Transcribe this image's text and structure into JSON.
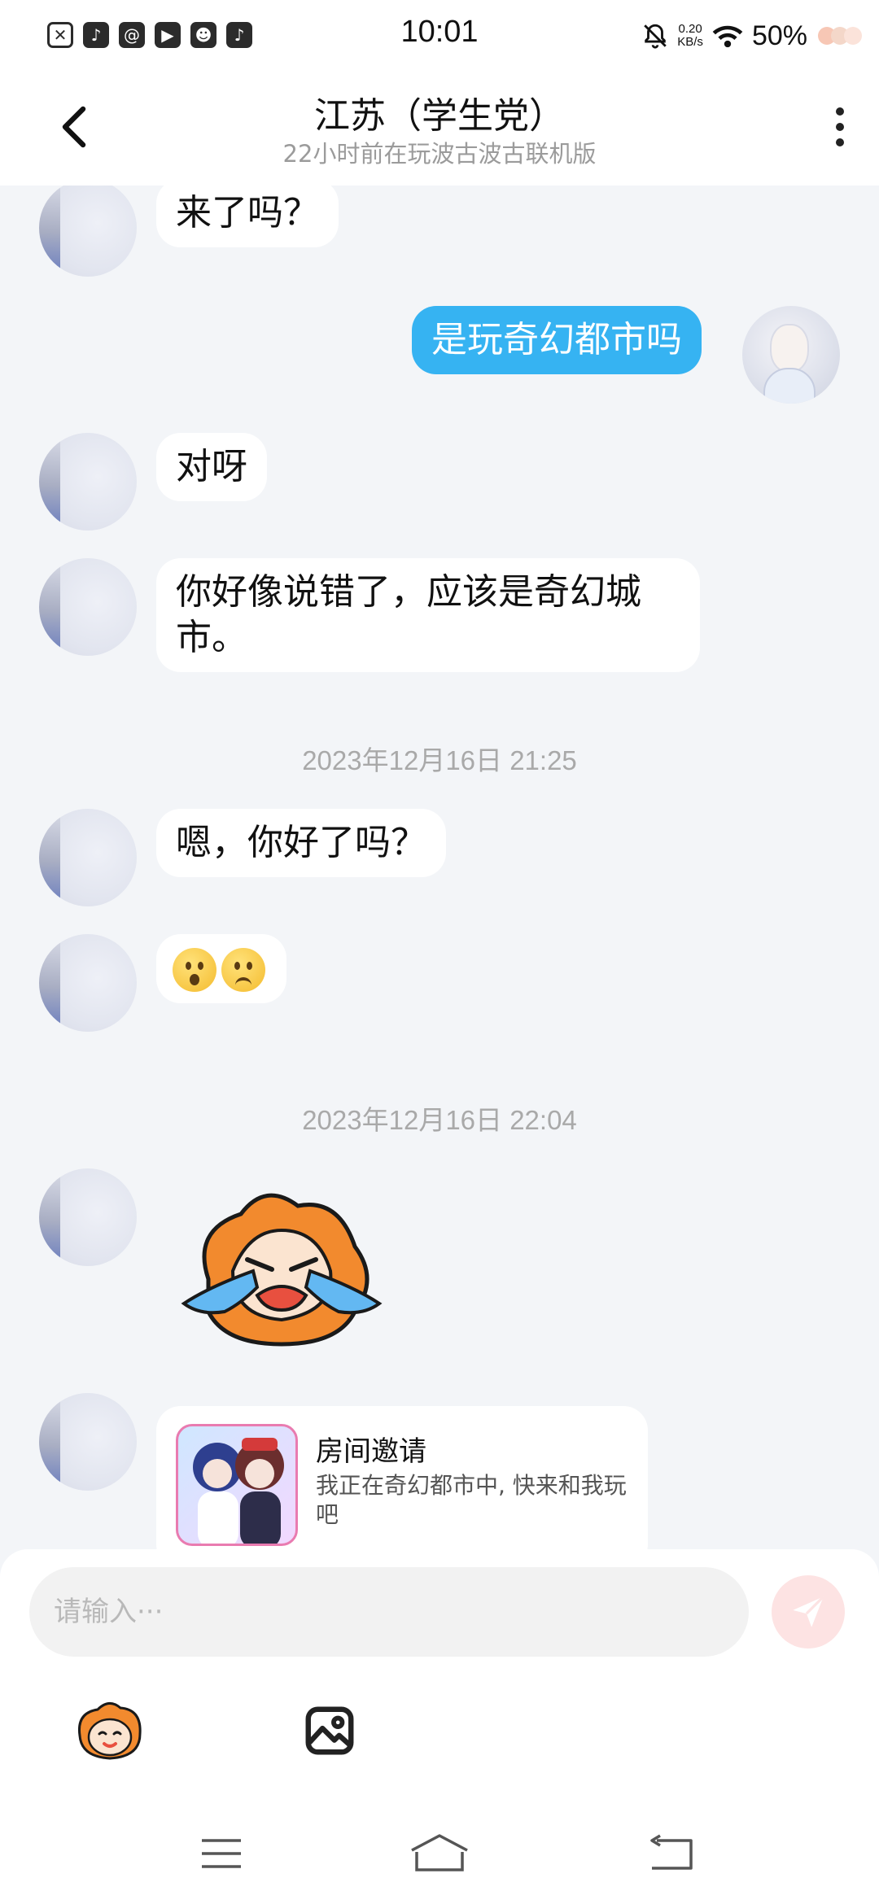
{
  "status_bar": {
    "time": "10:01",
    "net_speed_value": "0.20",
    "net_speed_unit": "KB/s",
    "battery": "50%",
    "app_icons": [
      "close-box-icon",
      "tiktok-icon",
      "at-mail-icon",
      "video-play-icon",
      "game-face-icon",
      "tiktok-icon"
    ]
  },
  "header": {
    "title": "江苏（学生党）",
    "subtitle": "22小时前在玩波古波古联机版"
  },
  "messages": [
    {
      "side": "left",
      "text": "来了吗？"
    },
    {
      "side": "right",
      "text": "是玩奇幻都市吗"
    },
    {
      "side": "left",
      "text": "对呀"
    },
    {
      "side": "left",
      "text_line1": "你好像说错了，应该是奇幻城",
      "text_line2": "市。"
    },
    {
      "type": "timestamp",
      "text": "2023年12月16日 21:25"
    },
    {
      "side": "left",
      "text": "嗯，你好了吗？"
    },
    {
      "side": "left",
      "emojis": [
        "astonished-face",
        "slightly-frowning-face"
      ]
    },
    {
      "type": "timestamp",
      "text": "2023年12月16日 22:04"
    },
    {
      "side": "left",
      "sticker": "crying-mascot-sticker"
    },
    {
      "side": "left",
      "card": {
        "title": "房间邀请",
        "desc": "我正在奇幻都市中, 快来和我玩吧"
      }
    }
  ],
  "input": {
    "placeholder": "请输入···"
  },
  "colors": {
    "accent": "#36b3f2",
    "background": "#f3f5f8",
    "send_button": "#fde3e3"
  }
}
